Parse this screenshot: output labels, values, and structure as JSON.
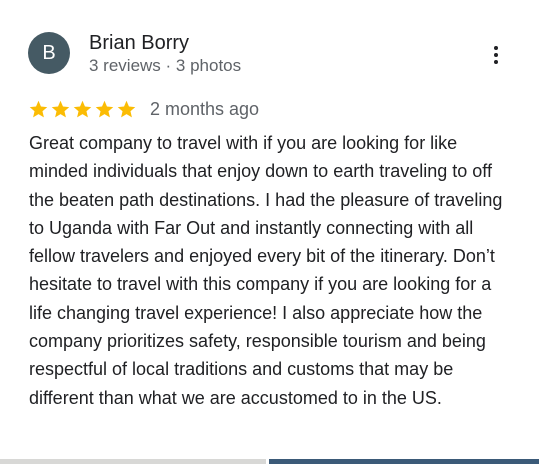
{
  "review": {
    "author": {
      "initial": "B",
      "name": "Brian Borry",
      "meta": "3 reviews · 3 photos",
      "avatar_color": "#455a64"
    },
    "menu_icon": "more-vert-icon",
    "rating": 5,
    "max_rating": 5,
    "star_color": "#fbbc04",
    "time": "2 months ago",
    "text": "Great company to travel with if you are looking for like minded individuals that enjoy down to earth traveling to off the beaten path destinations. I had the pleasure of traveling to Uganda with Far Out and instantly connecting with all fellow travelers and enjoyed every bit of the itinerary. Don’t hesitate to travel with this company if you are looking for a life changing travel experience! I also appreciate how the company prioritizes safety, responsible tourism and being respectful of local traditions and customs that may be different than what we are accustomed to in the US."
  },
  "photos": {
    "thumbnail_colors": [
      "#d8d8d6",
      "#3b5a78"
    ]
  }
}
